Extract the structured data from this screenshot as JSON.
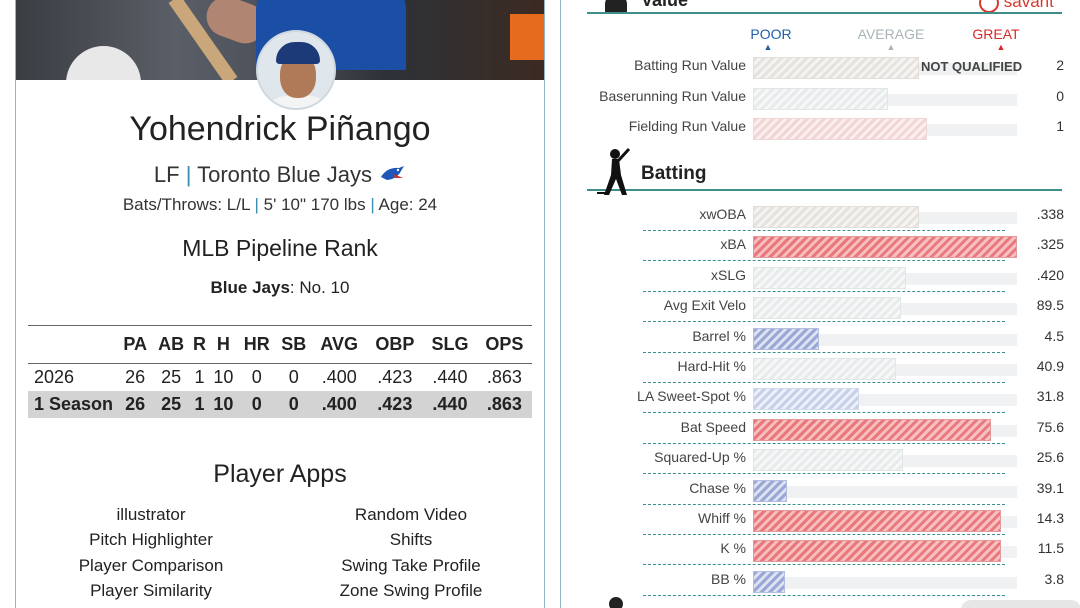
{
  "player": {
    "name": "Yohendrick Piñango",
    "position": "LF",
    "team": "Toronto Blue Jays",
    "bats_throws_label": "Bats/Throws: L/L",
    "height_weight": "5' 10\" 170 lbs",
    "age_label": "Age: 24"
  },
  "pipeline": {
    "title": "MLB Pipeline Rank",
    "team_label": "Blue Jays",
    "rank_text": ": No. 10"
  },
  "stats_table": {
    "headers": [
      "",
      "PA",
      "AB",
      "R",
      "H",
      "HR",
      "SB",
      "AVG",
      "OBP",
      "SLG",
      "OPS"
    ],
    "rows": [
      [
        "2026",
        "26",
        "25",
        "1",
        "10",
        "0",
        "0",
        ".400",
        ".423",
        ".440",
        ".863"
      ],
      [
        "1 Season",
        "26",
        "25",
        "1",
        "10",
        "0",
        "0",
        ".400",
        ".423",
        ".440",
        ".863"
      ]
    ]
  },
  "apps": {
    "title": "Player Apps",
    "left": [
      "illustrator",
      "Pitch Highlighter",
      "Player Comparison",
      "Player Similarity"
    ],
    "right": [
      "Random Video",
      "Shifts",
      "Swing Take Profile",
      "Zone Swing Profile"
    ]
  },
  "value_section": {
    "title": "Value",
    "brand": "savant",
    "scale": {
      "poor": "POOR",
      "average": "AVERAGE",
      "great": "GREAT"
    },
    "scale_colors": {
      "poor": "#1f5fa8",
      "average": "#a8b4b8",
      "great": "#d62b2b"
    },
    "rows": [
      {
        "label": "Batting Run Value",
        "value": "2",
        "note": "NOT QUALIFIED",
        "fill_pct": 0.63,
        "fill": "grey"
      },
      {
        "label": "Baserunning Run Value",
        "value": "0",
        "fill_pct": 0.51,
        "fill": "lightgrey"
      },
      {
        "label": "Fielding Run Value",
        "value": "1",
        "fill_pct": 0.66,
        "fill": "pink"
      }
    ]
  },
  "batting_section": {
    "title": "Batting",
    "rows": [
      {
        "label": "xwOBA",
        "value": ".338",
        "fill_pct": 0.63,
        "fill": "grey"
      },
      {
        "label": "xBA",
        "value": ".325",
        "fill_pct": 1.0,
        "fill": "red"
      },
      {
        "label": "xSLG",
        "value": ".420",
        "fill_pct": 0.58,
        "fill": "lightgrey"
      },
      {
        "label": "Avg Exit Velo",
        "value": "89.5",
        "fill_pct": 0.56,
        "fill": "lightgrey"
      },
      {
        "label": "Barrel %",
        "value": "4.5",
        "fill_pct": 0.25,
        "fill": "blue"
      },
      {
        "label": "Hard-Hit %",
        "value": "40.9",
        "fill_pct": 0.54,
        "fill": "lightgrey"
      },
      {
        "label": "LA Sweet-Spot %",
        "value": "31.8",
        "fill_pct": 0.4,
        "fill": "lightblue"
      },
      {
        "label": "Bat Speed",
        "value": "75.6",
        "fill_pct": 0.9,
        "fill": "red"
      },
      {
        "label": "Squared-Up %",
        "value": "25.6",
        "fill_pct": 0.57,
        "fill": "lightgrey"
      },
      {
        "label": "Chase %",
        "value": "39.1",
        "fill_pct": 0.13,
        "fill": "blue"
      },
      {
        "label": "Whiff %",
        "value": "14.3",
        "fill_pct": 0.94,
        "fill": "red"
      },
      {
        "label": "K %",
        "value": "11.5",
        "fill_pct": 0.94,
        "fill": "red"
      },
      {
        "label": "BB %",
        "value": "3.8",
        "fill_pct": 0.12,
        "fill": "blue"
      }
    ]
  }
}
